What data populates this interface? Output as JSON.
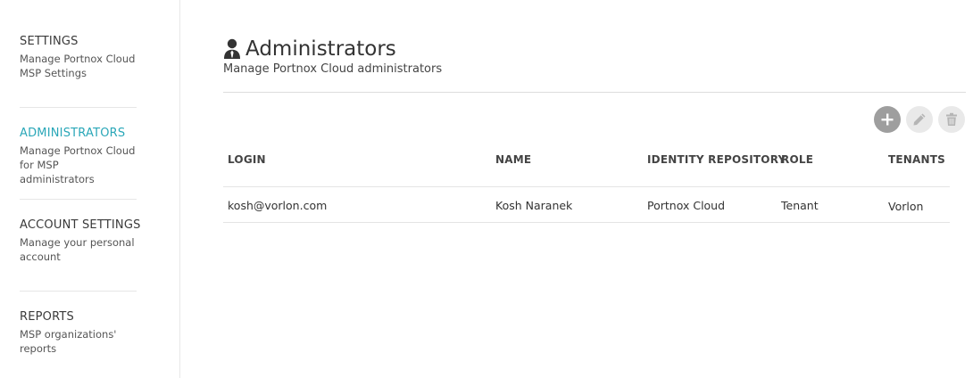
{
  "sidebar": {
    "items": [
      {
        "title": "SETTINGS",
        "desc": "Manage Portnox Cloud MSP Settings",
        "active": false
      },
      {
        "title": "ADMINISTRATORS",
        "desc": "Manage Portnox Cloud for MSP administrators",
        "active": true
      },
      {
        "title": "ACCOUNT SETTINGS",
        "desc": "Manage your personal account",
        "active": false
      },
      {
        "title": "REPORTS",
        "desc": "MSP organizations' reports",
        "active": false
      }
    ]
  },
  "header": {
    "title": "Administrators",
    "subtitle": "Manage Portnox Cloud administrators",
    "icon": "admin-user-icon"
  },
  "toolbar": {
    "buttons": [
      {
        "icon": "plus-icon",
        "name": "add-button",
        "enabled": true
      },
      {
        "icon": "pencil-icon",
        "name": "edit-button",
        "enabled": false
      },
      {
        "icon": "trash-icon",
        "name": "delete-button",
        "enabled": false
      }
    ]
  },
  "table": {
    "columns": [
      "LOGIN",
      "NAME",
      "IDENTITY REPOSITORY",
      "ROLE",
      "TENANTS"
    ],
    "rows": [
      [
        "kosh@vorlon.com",
        "Kosh Naranek",
        "Portnox Cloud",
        "Tenant",
        "Vorlon"
      ]
    ]
  },
  "colors": {
    "accent": "#2aa7b8",
    "add_button": "#9e9e9e",
    "disabled_button": "#e9e9e9"
  }
}
